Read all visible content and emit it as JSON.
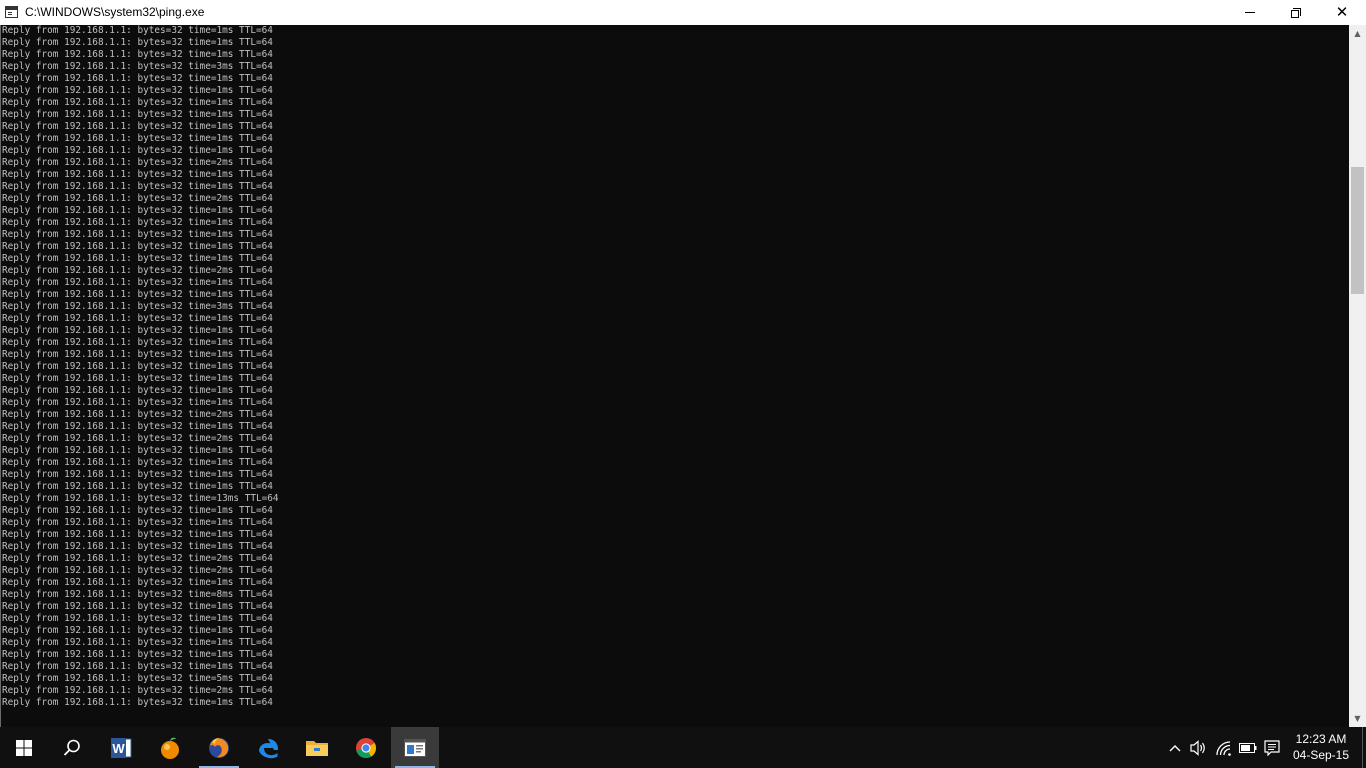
{
  "window": {
    "title": "C:\\WINDOWS\\system32\\ping.exe"
  },
  "console": {
    "lines": [
      "Reply from 192.168.1.1: bytes=32 time=1ms TTL=64",
      "Reply from 192.168.1.1: bytes=32 time=1ms TTL=64",
      "Reply from 192.168.1.1: bytes=32 time=1ms TTL=64",
      "Reply from 192.168.1.1: bytes=32 time=3ms TTL=64",
      "Reply from 192.168.1.1: bytes=32 time=1ms TTL=64",
      "Reply from 192.168.1.1: bytes=32 time=1ms TTL=64",
      "Reply from 192.168.1.1: bytes=32 time=1ms TTL=64",
      "Reply from 192.168.1.1: bytes=32 time=1ms TTL=64",
      "Reply from 192.168.1.1: bytes=32 time=1ms TTL=64",
      "Reply from 192.168.1.1: bytes=32 time=1ms TTL=64",
      "Reply from 192.168.1.1: bytes=32 time=1ms TTL=64",
      "Reply from 192.168.1.1: bytes=32 time=2ms TTL=64",
      "Reply from 192.168.1.1: bytes=32 time=1ms TTL=64",
      "Reply from 192.168.1.1: bytes=32 time=1ms TTL=64",
      "Reply from 192.168.1.1: bytes=32 time=2ms TTL=64",
      "Reply from 192.168.1.1: bytes=32 time=1ms TTL=64",
      "Reply from 192.168.1.1: bytes=32 time=1ms TTL=64",
      "Reply from 192.168.1.1: bytes=32 time=1ms TTL=64",
      "Reply from 192.168.1.1: bytes=32 time=1ms TTL=64",
      "Reply from 192.168.1.1: bytes=32 time=1ms TTL=64",
      "Reply from 192.168.1.1: bytes=32 time=2ms TTL=64",
      "Reply from 192.168.1.1: bytes=32 time=1ms TTL=64",
      "Reply from 192.168.1.1: bytes=32 time=1ms TTL=64",
      "Reply from 192.168.1.1: bytes=32 time=3ms TTL=64",
      "Reply from 192.168.1.1: bytes=32 time=1ms TTL=64",
      "Reply from 192.168.1.1: bytes=32 time=1ms TTL=64",
      "Reply from 192.168.1.1: bytes=32 time=1ms TTL=64",
      "Reply from 192.168.1.1: bytes=32 time=1ms TTL=64",
      "Reply from 192.168.1.1: bytes=32 time=1ms TTL=64",
      "Reply from 192.168.1.1: bytes=32 time=1ms TTL=64",
      "Reply from 192.168.1.1: bytes=32 time=1ms TTL=64",
      "Reply from 192.168.1.1: bytes=32 time=1ms TTL=64",
      "Reply from 192.168.1.1: bytes=32 time=2ms TTL=64",
      "Reply from 192.168.1.1: bytes=32 time=1ms TTL=64",
      "Reply from 192.168.1.1: bytes=32 time=2ms TTL=64",
      "Reply from 192.168.1.1: bytes=32 time=1ms TTL=64",
      "Reply from 192.168.1.1: bytes=32 time=1ms TTL=64",
      "Reply from 192.168.1.1: bytes=32 time=1ms TTL=64",
      "Reply from 192.168.1.1: bytes=32 time=1ms TTL=64",
      "Reply from 192.168.1.1: bytes=32 time=13ms TTL=64",
      "Reply from 192.168.1.1: bytes=32 time=1ms TTL=64",
      "Reply from 192.168.1.1: bytes=32 time=1ms TTL=64",
      "Reply from 192.168.1.1: bytes=32 time=1ms TTL=64",
      "Reply from 192.168.1.1: bytes=32 time=1ms TTL=64",
      "Reply from 192.168.1.1: bytes=32 time=2ms TTL=64",
      "Reply from 192.168.1.1: bytes=32 time=2ms TTL=64",
      "Reply from 192.168.1.1: bytes=32 time=1ms TTL=64",
      "Reply from 192.168.1.1: bytes=32 time=8ms TTL=64",
      "Reply from 192.168.1.1: bytes=32 time=1ms TTL=64",
      "Reply from 192.168.1.1: bytes=32 time=1ms TTL=64",
      "Reply from 192.168.1.1: bytes=32 time=1ms TTL=64",
      "Reply from 192.168.1.1: bytes=32 time=1ms TTL=64",
      "Reply from 192.168.1.1: bytes=32 time=1ms TTL=64",
      "Reply from 192.168.1.1: bytes=32 time=1ms TTL=64",
      "Reply from 192.168.1.1: bytes=32 time=5ms TTL=64",
      "Reply from 192.168.1.1: bytes=32 time=2ms TTL=64",
      "Reply from 192.168.1.1: bytes=32 time=1ms TTL=64"
    ]
  },
  "taskbar": {
    "items": [
      {
        "name": "start-button",
        "icon": "windows-logo-icon"
      },
      {
        "name": "search-button",
        "icon": "search-icon"
      },
      {
        "name": "word-app",
        "icon": "word-icon"
      },
      {
        "name": "app-orange",
        "icon": "fruit-icon"
      },
      {
        "name": "firefox-app",
        "icon": "firefox-icon"
      },
      {
        "name": "edge-app",
        "icon": "edge-icon"
      },
      {
        "name": "file-explorer-app",
        "icon": "folder-icon"
      },
      {
        "name": "chrome-app",
        "icon": "chrome-icon"
      },
      {
        "name": "console-app",
        "icon": "console-icon",
        "active": true
      }
    ],
    "tray_icons": [
      "chevron-up-icon",
      "volume-icon",
      "wifi-icon",
      "battery-icon",
      "notification-icon"
    ],
    "clock": {
      "time": "12:23 AM",
      "date": "04-Sep-15"
    }
  },
  "colors": {
    "console_bg": "#0c0c0c",
    "console_text": "#c0c0c0",
    "taskbar_bg": "#101010",
    "accent": "#8fb6e8"
  }
}
